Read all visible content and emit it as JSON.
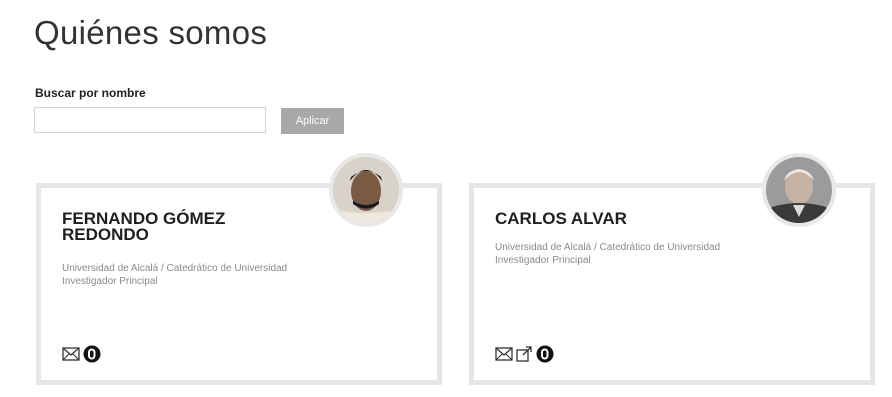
{
  "page": {
    "title": "Quiénes somos"
  },
  "search": {
    "label": "Buscar por nombre",
    "value": "",
    "placeholder": "",
    "apply_label": "Aplicar"
  },
  "members": [
    {
      "name": "FERNANDO GÓMEZ REDONDO",
      "affiliation_line1": "Universidad de Alcalá / Catedrático de Universidad",
      "affiliation_line2": "Investigador Principal",
      "icons": [
        "envelope-icon",
        "orcid-icon"
      ]
    },
    {
      "name": "CARLOS ALVAR",
      "affiliation_line1": "Universidad de Alcalá / Catedrático de Universidad",
      "affiliation_line2": "Investigador Principal",
      "icons": [
        "envelope-icon",
        "external-link-icon",
        "orcid-icon"
      ]
    }
  ],
  "colors": {
    "card_border": "#e6e6e6",
    "button_bg": "#a8a8a8",
    "muted_text": "#8a8a8a"
  }
}
